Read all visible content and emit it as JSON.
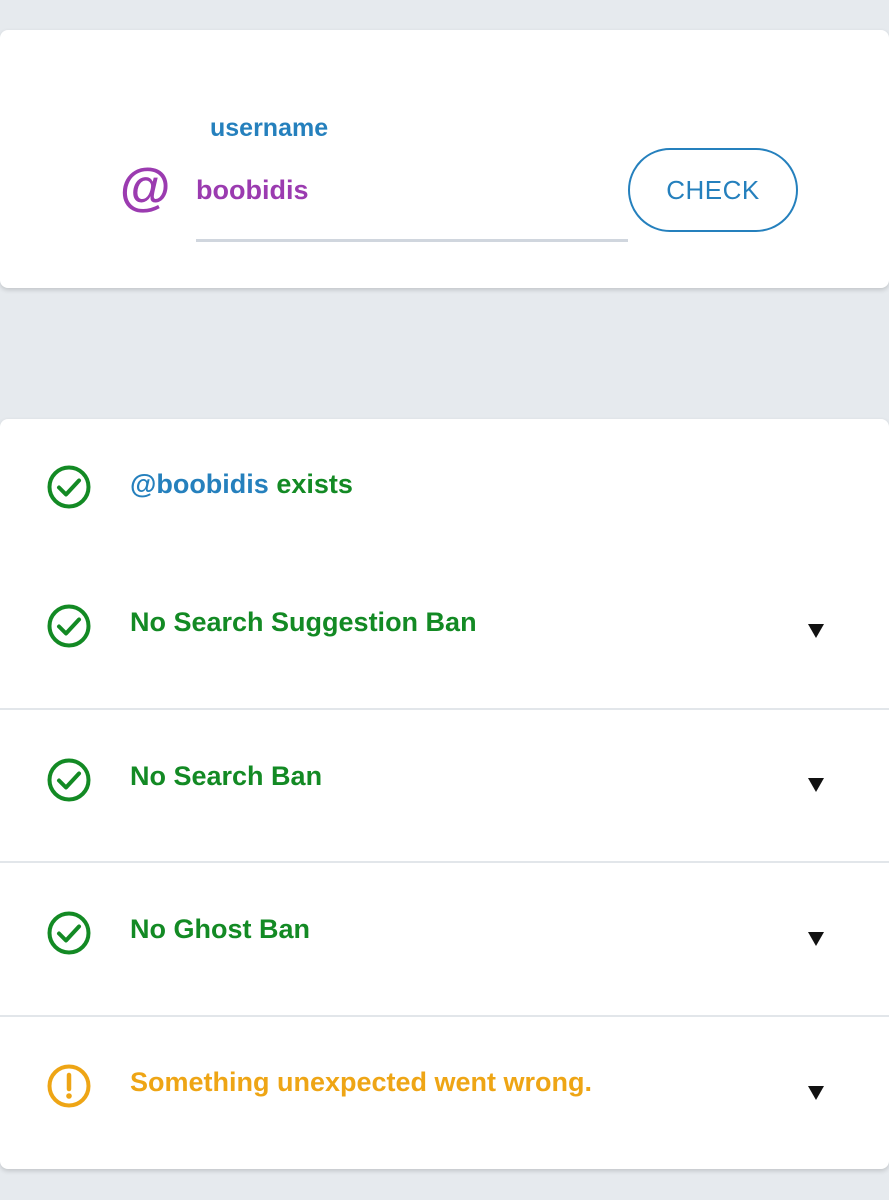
{
  "search": {
    "label": "username",
    "at_symbol": "@",
    "value": "boobidis",
    "button_label": "CHECK"
  },
  "results": [
    {
      "handle": "@boobidis",
      "text": " exists",
      "status": "ok",
      "icon": "check-circle-icon",
      "expandable": false
    },
    {
      "text": "No Search Suggestion Ban",
      "status": "ok",
      "icon": "check-circle-icon",
      "expandable": true
    },
    {
      "text": "No Search Ban",
      "status": "ok",
      "icon": "check-circle-icon",
      "expandable": true
    },
    {
      "text": "No Ghost Ban",
      "status": "ok",
      "icon": "check-circle-icon",
      "expandable": true
    },
    {
      "text": "Something unexpected went wrong.",
      "status": "warning",
      "icon": "alert-circle-icon",
      "expandable": true
    }
  ],
  "colors": {
    "background": "#e6eaee",
    "accent_blue": "#2580bd",
    "accent_purple": "#9b3bb0",
    "ok_green": "#138a24",
    "warning_orange": "#eea515"
  }
}
